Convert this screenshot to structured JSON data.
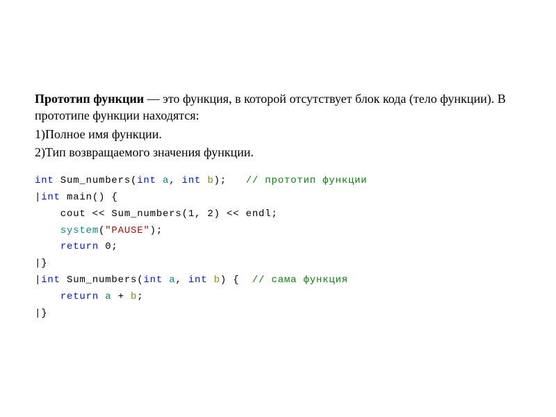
{
  "text": {
    "p1a": "Прототип функции",
    "p1b": " — это функция, в которой отсутствует блок кода (тело функции). В прототипе функции находятся:",
    "p2": "1)Полное имя функции.",
    "p3": "2)Тип возвращаемого значения функции."
  },
  "code": {
    "l1": {
      "kw1": "int",
      "name": " Sum_numbers(",
      "kw2": "int",
      "sp1": " ",
      "a": "a",
      "comma": ", ",
      "kw3": "int",
      "sp2": " ",
      "b": "b",
      "close": ");",
      "pad": "   ",
      "comment": "// прототип функции"
    },
    "l2": "",
    "l3": {
      "bar": "|",
      "kw1": "int",
      "rest": " main() {"
    },
    "l4": {
      "indent": "    cout << Sum_numbers(1, 2) << endl;"
    },
    "l5": {
      "indent": "    ",
      "sys": "system",
      "open": "(",
      "str": "\"PAUSE\"",
      "close": ");"
    },
    "l6": {
      "indent": "    ",
      "kw": "return",
      "rest": " 0;"
    },
    "l7": {
      "bar": "|",
      "brace": "}"
    },
    "l8": "",
    "l9": {
      "bar": "|",
      "kw1": "int",
      "name": " Sum_numbers(",
      "kw2": "int",
      "sp1": " ",
      "a": "a",
      "comma": ", ",
      "kw3": "int",
      "sp2": " ",
      "b": "b",
      "close": ") {",
      "pad": "  ",
      "comment": "// сама функция"
    },
    "l10": {
      "indent": "    ",
      "kw": "return",
      "sp": " ",
      "a": "a",
      "plus": " + ",
      "b": "b",
      "semi": ";"
    },
    "l11": {
      "bar": "|",
      "brace": "}"
    }
  }
}
